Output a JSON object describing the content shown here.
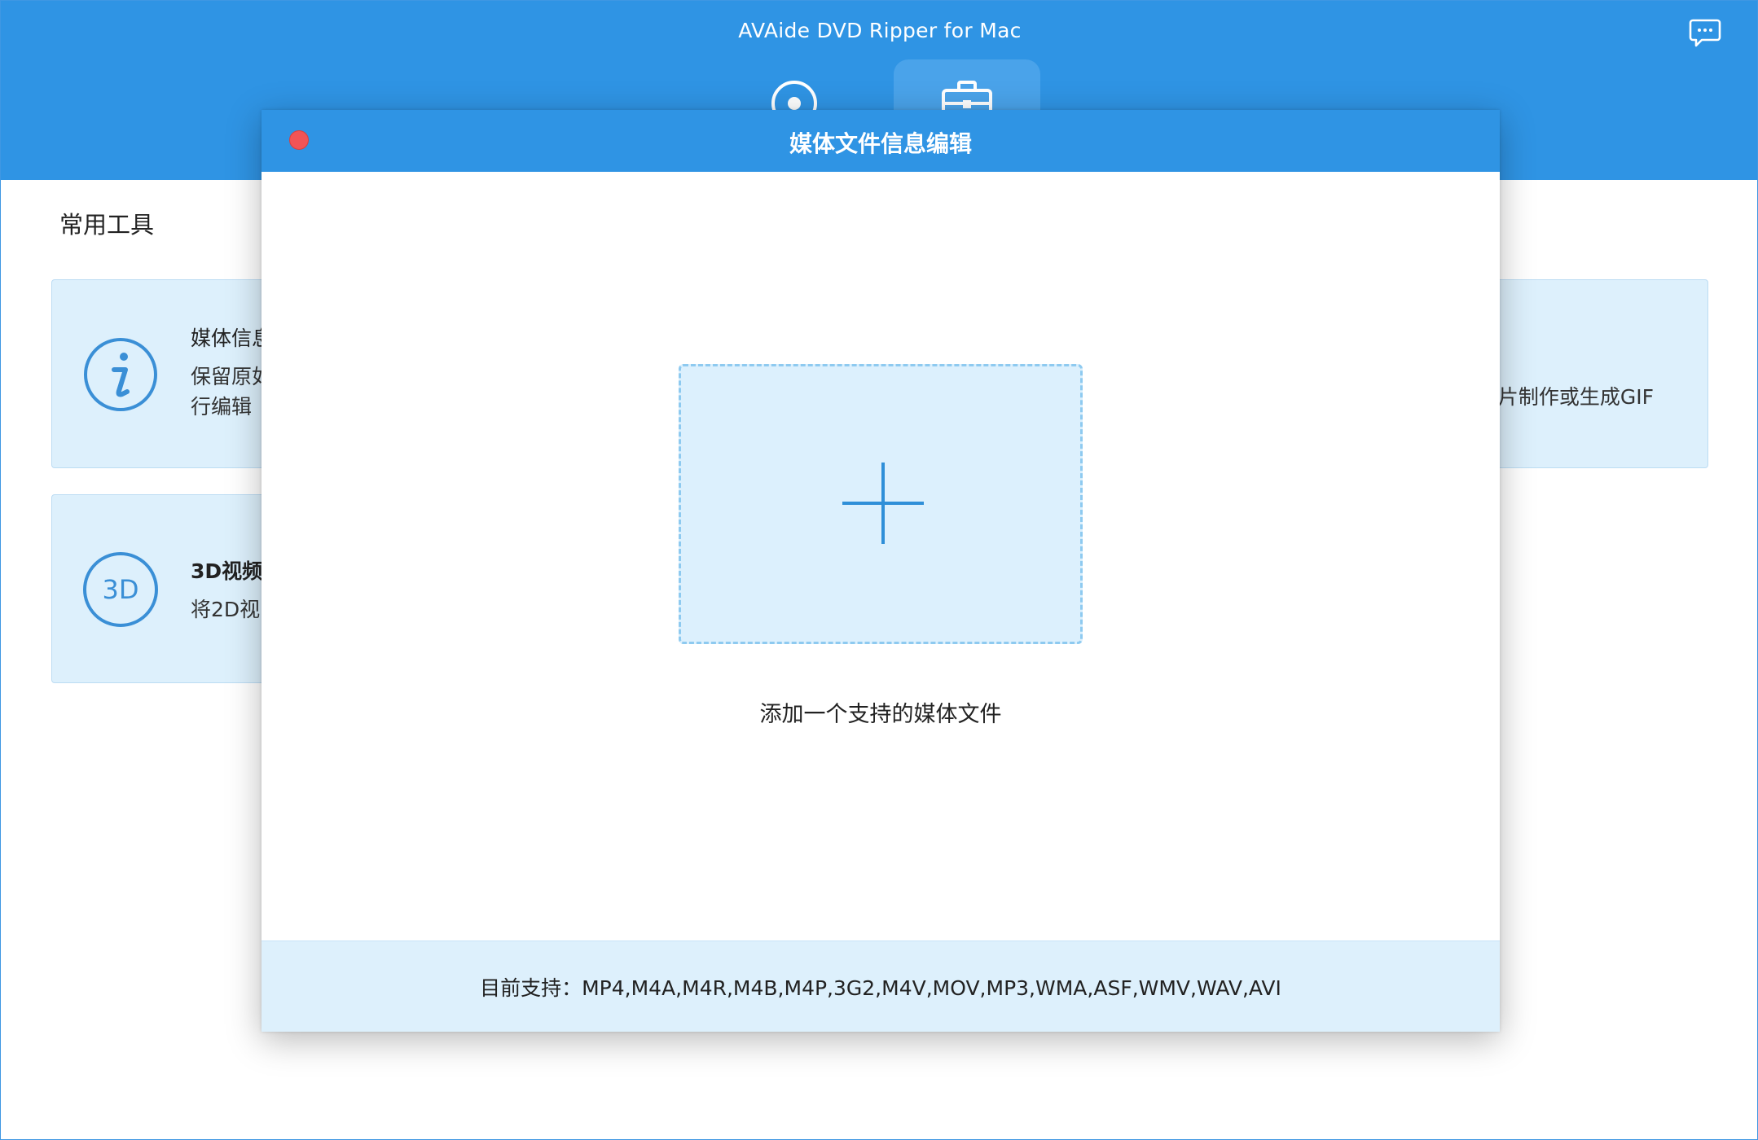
{
  "app": {
    "title": "AVAide DVD Ripper for Mac"
  },
  "header": {
    "tabs": [
      {
        "icon": "disc-icon"
      },
      {
        "icon": "toolbox-icon",
        "selected": true
      }
    ],
    "feedback_icon": "chat-bubble-icon"
  },
  "toolbox": {
    "section_title": "常用工具",
    "cards": [
      {
        "name": "媒体信息",
        "desc": "保留原如\n行编辑",
        "icon": "info-icon"
      },
      {
        "name": "3D视频",
        "desc": "将2D视",
        "icon": "3d-icon",
        "icon_text": "3D"
      },
      {
        "desc": "片制作或生成GIF"
      }
    ]
  },
  "modal": {
    "title": "媒体文件信息编辑",
    "drop_label": "添加一个支持的媒体文件",
    "supported_formats": "目前支持：MP4,M4A,M4R,M4B,M4P,3G2,M4V,MOV,MP3,WMA,ASF,WMV,WAV,AVI"
  },
  "colors": {
    "header_blue": "#2f94e4",
    "card_bg": "#ddf0fc",
    "drop_zone_bg": "#dcf0fd",
    "close_red": "#f25456",
    "icon_blue": "#3a8fd6"
  }
}
